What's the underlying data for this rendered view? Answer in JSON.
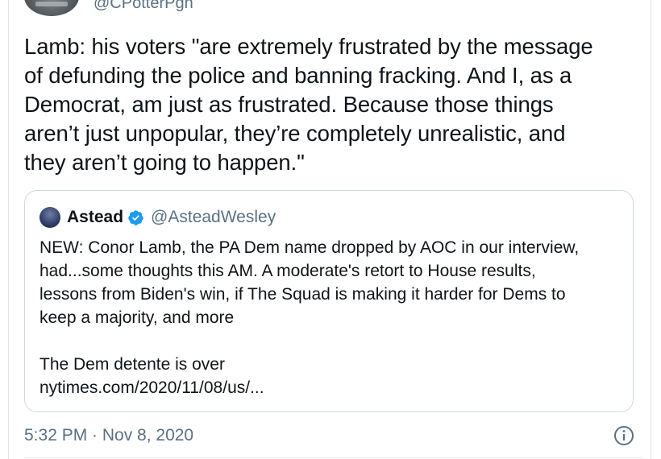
{
  "author": {
    "handle": "@CPotterPgh"
  },
  "tweet": {
    "text": "Lamb: his voters \"are extremely frustrated by the message\nof defunding the police and banning fracking. And I, as a\nDemocrat, am just as frustrated. Because those things\naren’t just unpopular, they’re completely unrealistic, and\nthey aren’t going to happen.\"",
    "timestamp": "5:32 PM · Nov 8, 2020"
  },
  "quoted_tweet": {
    "name": "Astead",
    "handle": "@AsteadWesley",
    "verified": true,
    "text": "NEW: Conor Lamb, the PA Dem name dropped by AOC in our interview,\nhad...some thoughts this AM. A moderate's retort to House results,\nlessons from Biden's win, if The Squad is making it harder for Dems to\nkeep a majority, and more\n\nThe Dem detente is over\nnytimes.com/2020/11/08/us/..."
  },
  "icons": {
    "verified": "verified-badge-icon",
    "info": "info-icon"
  },
  "colors": {
    "verified_blue": "#1d9bf0",
    "secondary_text": "#5b7083",
    "border": "#cfd9de"
  }
}
